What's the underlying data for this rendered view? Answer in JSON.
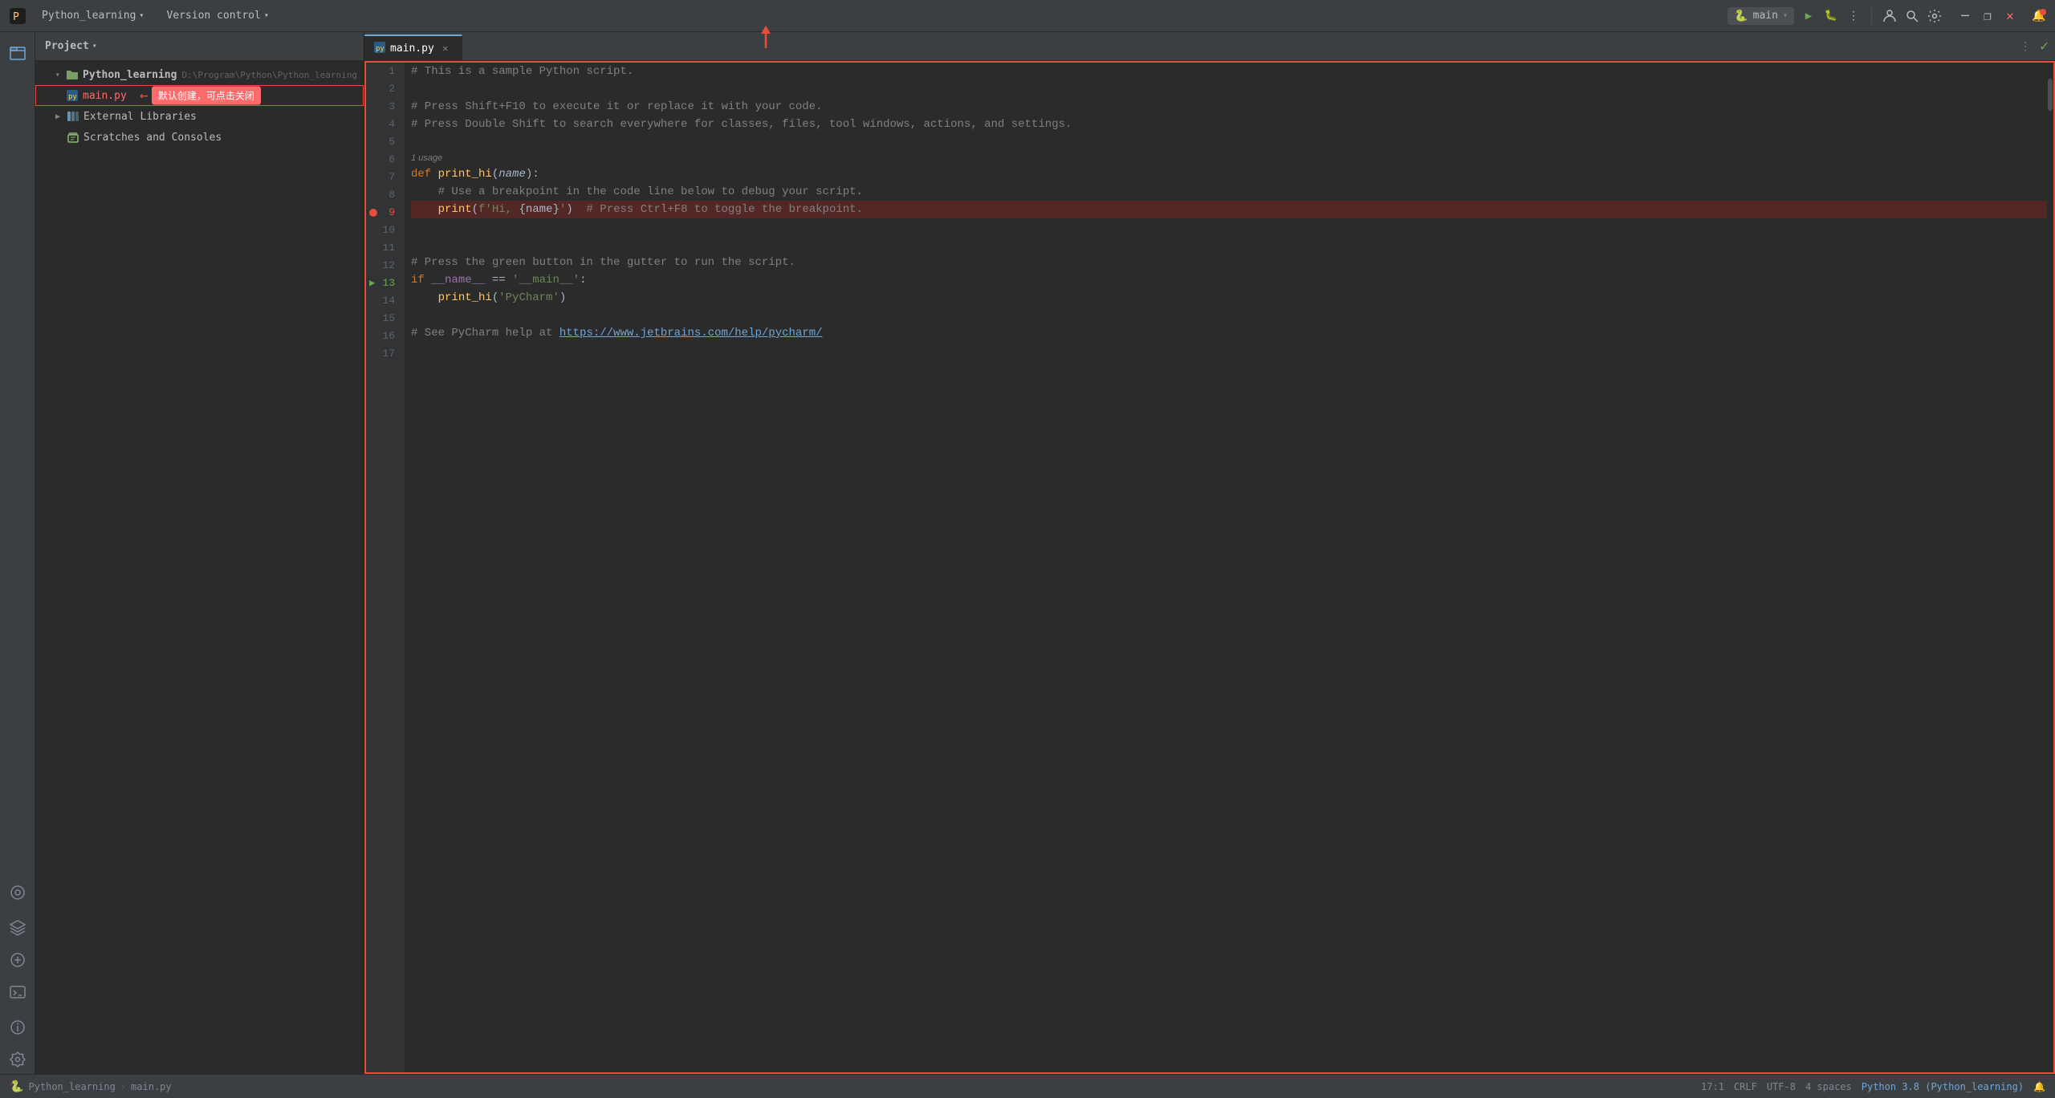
{
  "titlebar": {
    "logo": "🐍",
    "project_name": "Python_learning",
    "chevron": "∨",
    "version_control": "Version control",
    "version_chevron": "∨",
    "run_config": "main",
    "run_chevron": "∨",
    "btn_run": "▶",
    "btn_debug": "🐛",
    "btn_more": "⋮",
    "btn_profile": "👤",
    "btn_search": "🔍",
    "btn_settings": "⚙",
    "btn_minimize": "─",
    "btn_restore": "❐",
    "btn_close": "✕",
    "notification_icon": "🔔"
  },
  "sidebar_icons": {
    "project_icon": "📁",
    "structure_icon": "⊞",
    "layers_icon": "≡",
    "refresh_icon": "↻",
    "terminal_icon": "▤",
    "info_icon": "ℹ",
    "settings_icon": "⚙"
  },
  "project_panel": {
    "title": "Project",
    "chevron": "∨",
    "tree": [
      {
        "id": "python_learning",
        "label": "Python_learning",
        "path": "D:\\Program\\Python\\Python_learning",
        "type": "root",
        "indent": 1,
        "expanded": true,
        "icon": "folder"
      },
      {
        "id": "main_py",
        "label": "main.py",
        "type": "file",
        "indent": 2,
        "selected": true,
        "icon": "python-file",
        "tooltip": "默认创建，可点击关闭"
      },
      {
        "id": "external_libraries",
        "label": "External Libraries",
        "type": "external",
        "indent": 1,
        "expanded": false,
        "icon": "library"
      },
      {
        "id": "scratches",
        "label": "Scratches and Consoles",
        "type": "scratch",
        "indent": 1,
        "icon": "scratches"
      }
    ]
  },
  "editor": {
    "tab_label": "main.py",
    "tab_icon": "🐍",
    "more_actions": "⋮",
    "checkmark": "✓",
    "code_lines": [
      {
        "num": 1,
        "content": "# This is a sample Python script.",
        "type": "comment"
      },
      {
        "num": 2,
        "content": "",
        "type": "empty"
      },
      {
        "num": 3,
        "content": "# Press Shift+F10 to execute it or replace it with your code.",
        "type": "comment"
      },
      {
        "num": 4,
        "content": "# Press Double Shift to search everywhere for classes, files, tool windows, actions, and settings.",
        "type": "comment"
      },
      {
        "num": 5,
        "content": "",
        "type": "empty"
      },
      {
        "num": 6,
        "content": "",
        "type": "empty"
      },
      {
        "num": 7,
        "content": "def print_hi(name):",
        "type": "def"
      },
      {
        "num": 8,
        "content": "    # Use a breakpoint in the code line below to debug your script.",
        "type": "comment_indent"
      },
      {
        "num": 9,
        "content": "    print(f'Hi, {name}')  # Press Ctrl+F8 to toggle the breakpoint.",
        "type": "breakpoint"
      },
      {
        "num": 10,
        "content": "",
        "type": "empty"
      },
      {
        "num": 11,
        "content": "",
        "type": "empty"
      },
      {
        "num": 12,
        "content": "# Press the green button in the gutter to run the script.",
        "type": "comment"
      },
      {
        "num": 13,
        "content": "if __name__ == '__main__':",
        "type": "if",
        "run": true
      },
      {
        "num": 14,
        "content": "    print_hi('PyCharm')",
        "type": "call"
      },
      {
        "num": 15,
        "content": "",
        "type": "empty"
      },
      {
        "num": 16,
        "content": "# See PyCharm help at https://www.jetbrains.com/help/pycharm/",
        "type": "comment_link"
      },
      {
        "num": 17,
        "content": "",
        "type": "empty"
      }
    ],
    "usage_hint": "1 usage"
  },
  "status_bar": {
    "project_icon": "🐍",
    "project_label": "Python_learning",
    "sep": ">",
    "file_label": "main.py",
    "position": "17:1",
    "line_separator": "CRLF",
    "encoding": "UTF-8",
    "indent": "4 spaces",
    "python_version": "Python 3.8 (Python_learning)",
    "notification_icon": "🔔"
  },
  "tooltip": {
    "text": "默认创建，可点击关闭"
  },
  "colors": {
    "breakpoint_red": "#e74c3c",
    "editor_bg": "#2b2b2b",
    "panel_bg": "#3c3f41",
    "accent_blue": "#6ea6d8",
    "green": "#6aa84f",
    "selected_bg": "#2d5481"
  }
}
